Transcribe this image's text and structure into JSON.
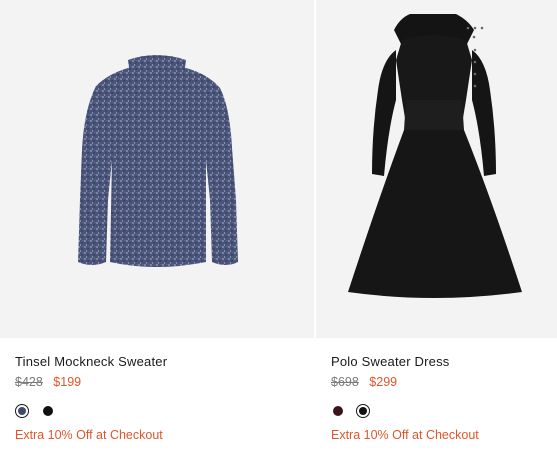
{
  "products": [
    {
      "name": "Tinsel Mockneck Sweater",
      "price_original": "$428",
      "price_sale": "$199",
      "promo": "Extra 10% Off at Checkout",
      "swatches": [
        {
          "color": "#3f4968",
          "selected": true
        },
        {
          "color": "#111111",
          "selected": false
        }
      ]
    },
    {
      "name": "Polo Sweater Dress",
      "price_original": "$698",
      "price_sale": "$299",
      "promo": "Extra 10% Off at Checkout",
      "swatches": [
        {
          "color": "#3a1618",
          "selected": false
        },
        {
          "color": "#111111",
          "selected": true
        }
      ]
    }
  ],
  "colors": {
    "sale": "#e0562a",
    "image_bg": "#f3f3f3"
  }
}
